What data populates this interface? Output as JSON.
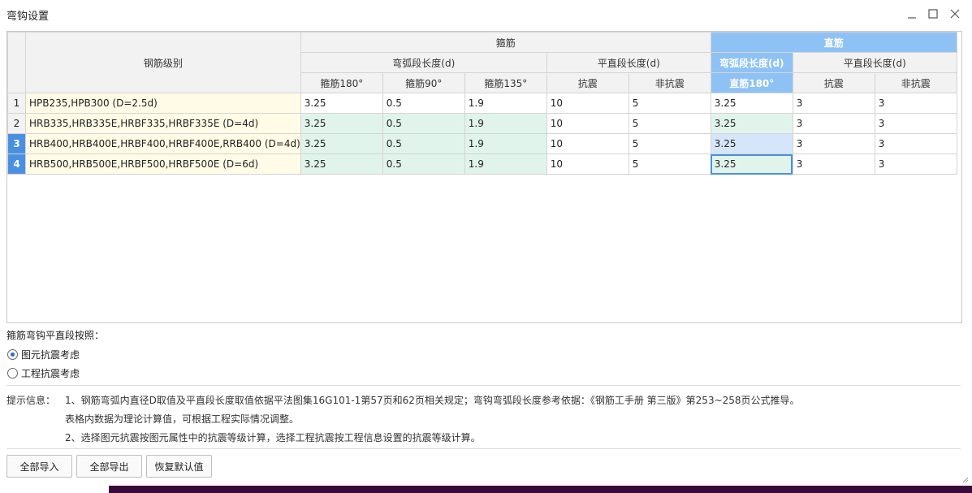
{
  "window": {
    "title": "弯钩设置"
  },
  "colors": {
    "accent": "#8ec2f5",
    "rowSelected": "#4a90e2",
    "nameCell": "#fffbe6",
    "mintCell": "#e0f4ec",
    "highlightCell": "#d5e6fa"
  },
  "table": {
    "header": {
      "grade": "钢筋级别",
      "stirrup": "箍筋",
      "straight": "直筋",
      "arc_length": "弯弧段长度(d)",
      "flat_length": "平直段长度(d)",
      "straight_arc_length": "弯弧段长度(d)",
      "straight_flat_length": "平直段长度(d)",
      "stirrup180": "箍筋180°",
      "stirrup90": "箍筋90°",
      "stirrup135": "箍筋135°",
      "seismic": "抗震",
      "nonseismic": "非抗震",
      "straight180": "直筋180°",
      "straight_seismic": "抗震",
      "straight_nonseismic": "非抗震"
    },
    "rows": [
      {
        "num": "1",
        "name": "HPB235,HPB300 (D=2.5d)",
        "v": [
          "3.25",
          "0.5",
          "1.9",
          "10",
          "5",
          "3.25",
          "3",
          "3"
        ]
      },
      {
        "num": "2",
        "name": "HRB335,HRB335E,HRBF335,HRBF335E (D=4d)",
        "v": [
          "3.25",
          "0.5",
          "1.9",
          "10",
          "5",
          "3.25",
          "3",
          "3"
        ]
      },
      {
        "num": "3",
        "name": "HRB400,HRB400E,HRBF400,HRBF400E,RRB400 (D=4d)",
        "v": [
          "3.25",
          "0.5",
          "1.9",
          "10",
          "5",
          "3.25",
          "3",
          "3"
        ]
      },
      {
        "num": "4",
        "name": "HRB500,HRB500E,HRBF500,HRBF500E (D=6d)",
        "v": [
          "3.25",
          "0.5",
          "1.9",
          "10",
          "5",
          "3.25",
          "3",
          "3"
        ]
      }
    ]
  },
  "options": {
    "label": "箍筋弯钩平直段按照：",
    "radio1": "图元抗震考虑",
    "radio2": "工程抗震考虑",
    "selected": "radio1"
  },
  "tips": {
    "label": "提示信息：",
    "line1": "1、钢筋弯弧内直径D取值及平直段长度取值依据平法图集16G101-1第57页和62页相关规定；弯钩弯弧段长度参考依据：《钢筋工手册  第三版》第253~258页公式推导。",
    "line2": "表格内数据为理论计算值，可根据工程实际情况调整。",
    "line3": "2、选择图元抗震按图元属性中的抗震等级计算，选择工程抗震按工程信息设置的抗震等级计算。"
  },
  "buttons": {
    "import_all": "全部导入",
    "export_all": "全部导出",
    "restore_default": "恢复默认值"
  }
}
